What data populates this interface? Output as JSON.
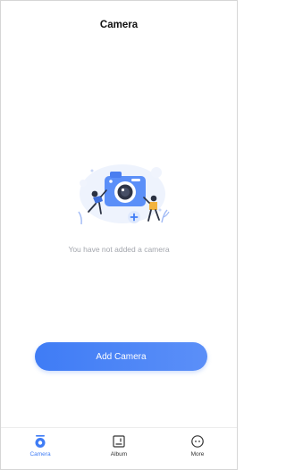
{
  "header": {
    "title": "Camera"
  },
  "empty_state": {
    "message": "You have not added a camera",
    "illustration_icon": "camera-illustration-icon"
  },
  "primary_action": {
    "label": "Add Camera"
  },
  "tabbar": {
    "active_color": "#3f7cf5",
    "items": [
      {
        "label": "Camera",
        "icon": "camera-tab-icon",
        "active": true
      },
      {
        "label": "Album",
        "icon": "album-tab-icon",
        "active": false
      },
      {
        "label": "More",
        "icon": "more-tab-icon",
        "active": false
      }
    ]
  },
  "colors": {
    "accent": "#3f7cf5",
    "muted_text": "#a3a6ad"
  }
}
